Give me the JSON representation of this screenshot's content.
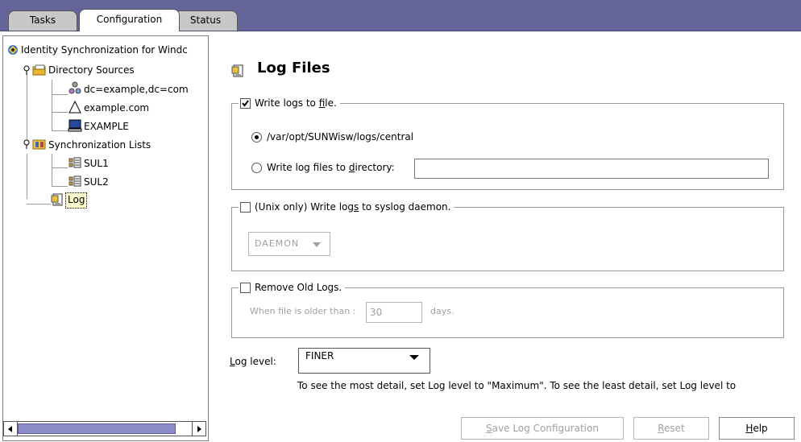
{
  "tabs": [
    {
      "label": "Tasks"
    },
    {
      "label": "Configuration"
    },
    {
      "label": "Status"
    }
  ],
  "tree": {
    "root": "Identity Synchronization for Windc",
    "directory_sources": "Directory Sources",
    "ds_children": [
      "dc=example,dc=com",
      "example.com",
      "EXAMPLE"
    ],
    "sync_lists": "Synchronization Lists",
    "sul_children": [
      "SUL1",
      "SUL2"
    ],
    "log": "Log"
  },
  "page": {
    "title": "Log Files"
  },
  "write_logs": {
    "label_pre": "Write logs to ",
    "label_mn": "f",
    "label_post": "ile.",
    "checked": true,
    "default_path": "/var/opt/SUNWisw/logs/central",
    "dir_label_pre": "Write log files to ",
    "dir_label_mn": "d",
    "dir_label_post": "irectory:",
    "dir_value": ""
  },
  "syslog": {
    "label_pre": "(Unix only) Write log",
    "label_mn": "s",
    "label_post": " to syslog daemon.",
    "checked": false,
    "facility": "DAEMON"
  },
  "remove_old": {
    "label": "Remove Old Logs.",
    "checked": false,
    "older_than_label": "When file is older than :",
    "days_value": "30",
    "days_label": "days."
  },
  "log_level": {
    "label_mn": "L",
    "label_post": "og level:",
    "value": "FINER",
    "hint": "To see the most detail, set Log level to \"Maximum\". To see the least detail, set Log level to"
  },
  "buttons": {
    "save_mn": "S",
    "save_post": "ave Log Configuration",
    "reset_mn": "R",
    "reset_post": "eset",
    "help_mn": "H",
    "help_post": "elp"
  },
  "colors": {
    "tabbar": "#65659c",
    "scroll_thumb": "#8c8cc8"
  }
}
